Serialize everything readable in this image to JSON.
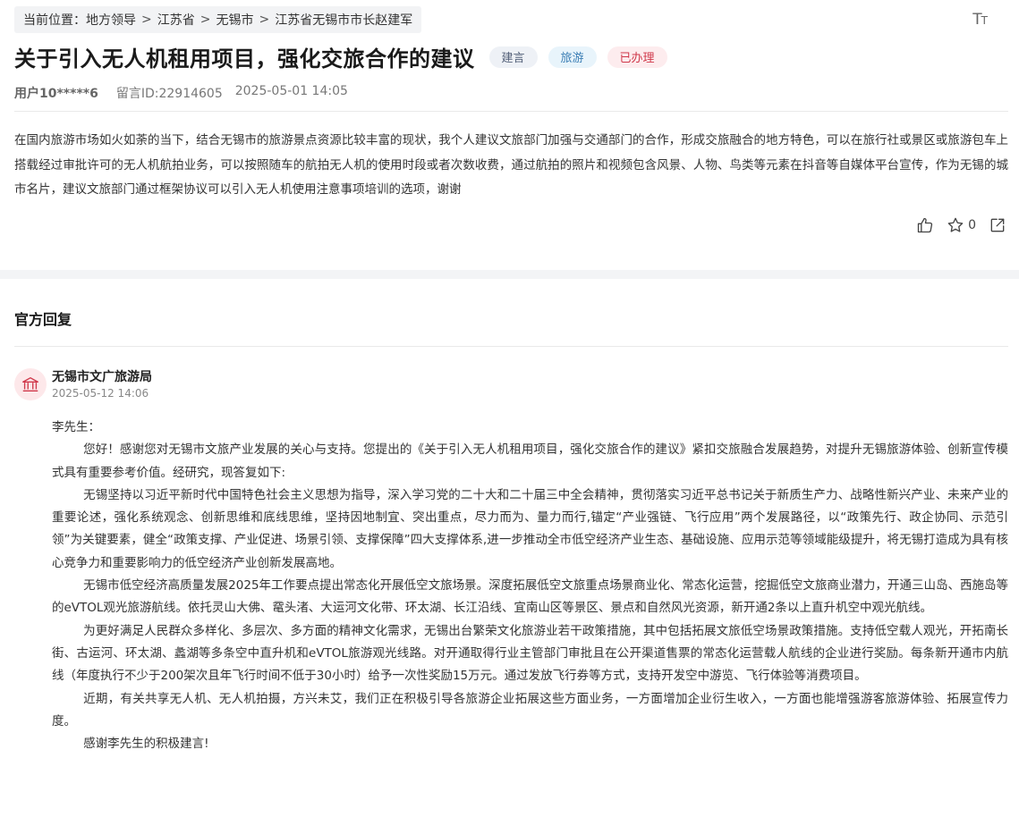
{
  "breadcrumb": {
    "prefix": "当前位置：",
    "items": [
      "地方领导",
      "江苏省",
      "无锡市",
      "江苏省无锡市市长赵建军"
    ],
    "separator": ">"
  },
  "font_size_button": {
    "big": "T",
    "small": "T",
    "icon": "font-size-icon"
  },
  "post": {
    "title": "关于引入无人机租用项目，强化交旅合作的建议",
    "tags": [
      "建言",
      "旅游",
      "已办理"
    ],
    "user": "用户10*****6",
    "message_id": "留言ID:22914605",
    "datetime": "2025-05-01 14:05",
    "content": "在国内旅游市场如火如荼的当下，结合无锡市的旅游景点资源比较丰富的现状，我个人建议文旅部门加强与交通部门的合作，形成交旅融合的地方特色，可以在旅行社或景区或旅游包车上搭载经过审批许可的无人机航拍业务，可以按照随车的航拍无人机的使用时段或者次数收费，通过航拍的照片和视频包含风景、人物、鸟类等元素在抖音等自媒体平台宣传，作为无锡的城市名片，建议文旅部门通过框架协议可以引入无人机使用注意事项培训的选项，谢谢",
    "star_count": "0"
  },
  "reply": {
    "section_title": "官方回复",
    "org": "无锡市文广旅游局",
    "datetime": "2025-05-12 14:06",
    "salutation": "李先生：",
    "paragraphs": [
      "您好！感谢您对无锡市文旅产业发展的关心与支持。您提出的《关于引入无人机租用项目，强化交旅合作的建议》紧扣交旅融合发展趋势，对提升无锡旅游体验、创新宣传模式具有重要参考价值。经研究，现答复如下:",
      "无锡坚持以习近平新时代中国特色社会主义思想为指导，深入学习党的二十大和二十届三中全会精神，贯彻落实习近平总书记关于新质生产力、战略性新兴产业、未来产业的重要论述，强化系统观念、创新思维和底线思维，坚持因地制宜、突出重点，尽力而为、量力而行,锚定“产业强链、飞行应用”两个发展路径，以“政策先行、政企协同、示范引领”为关键要素，健全“政策支撑、产业促进、场景引领、支撑保障”四大支撑体系,进一步推动全市低空经济产业生态、基础设施、应用示范等领域能级提升，将无锡打造成为具有核心竞争力和重要影响力的低空经济产业创新发展高地。",
      "无锡市低空经济高质量发展2025年工作要点提出常态化开展低空文旅场景。深度拓展低空文旅重点场景商业化、常态化运营，挖掘低空文旅商业潜力，开通三山岛、西施岛等的eVTOL观光旅游航线。依托灵山大佛、鼋头渚、大运河文化带、环太湖、长江沿线、宜南山区等景区、景点和自然风光资源，新开通2条以上直升机空中观光航线。",
      "为更好满足人民群众多样化、多层次、多方面的精神文化需求，无锡出台繁荣文化旅游业若干政策措施，其中包括拓展文旅低空场景政策措施。支持低空载人观光，开拓南长街、古运河、环太湖、蠡湖等多条空中直升机和eVTOL旅游观光线路。对开通取得行业主管部门审批且在公开渠道售票的常态化运营载人航线的企业进行奖励。每条新开通市内航线（年度执行不少于200架次且年飞行时间不低于30小时）给予一次性奖励15万元。通过发放飞行券等方式，支持开发空中游览、飞行体验等消费项目。",
      "近期，有关共享无人机、无人机拍摄，方兴未艾，我们正在积极引导各旅游企业拓展这些方面业务，一方面增加企业衍生收入，一方面也能增强游客旅游体验、拓展宣传力度。",
      "感谢李先生的积极建言!"
    ]
  },
  "colors": {
    "tag_suggestion": "#55627a",
    "tag_tourism": "#3c7fb5",
    "tag_done": "#d0394b",
    "avatar_bg": "#fde8ea",
    "avatar_icon": "#d0394b"
  }
}
